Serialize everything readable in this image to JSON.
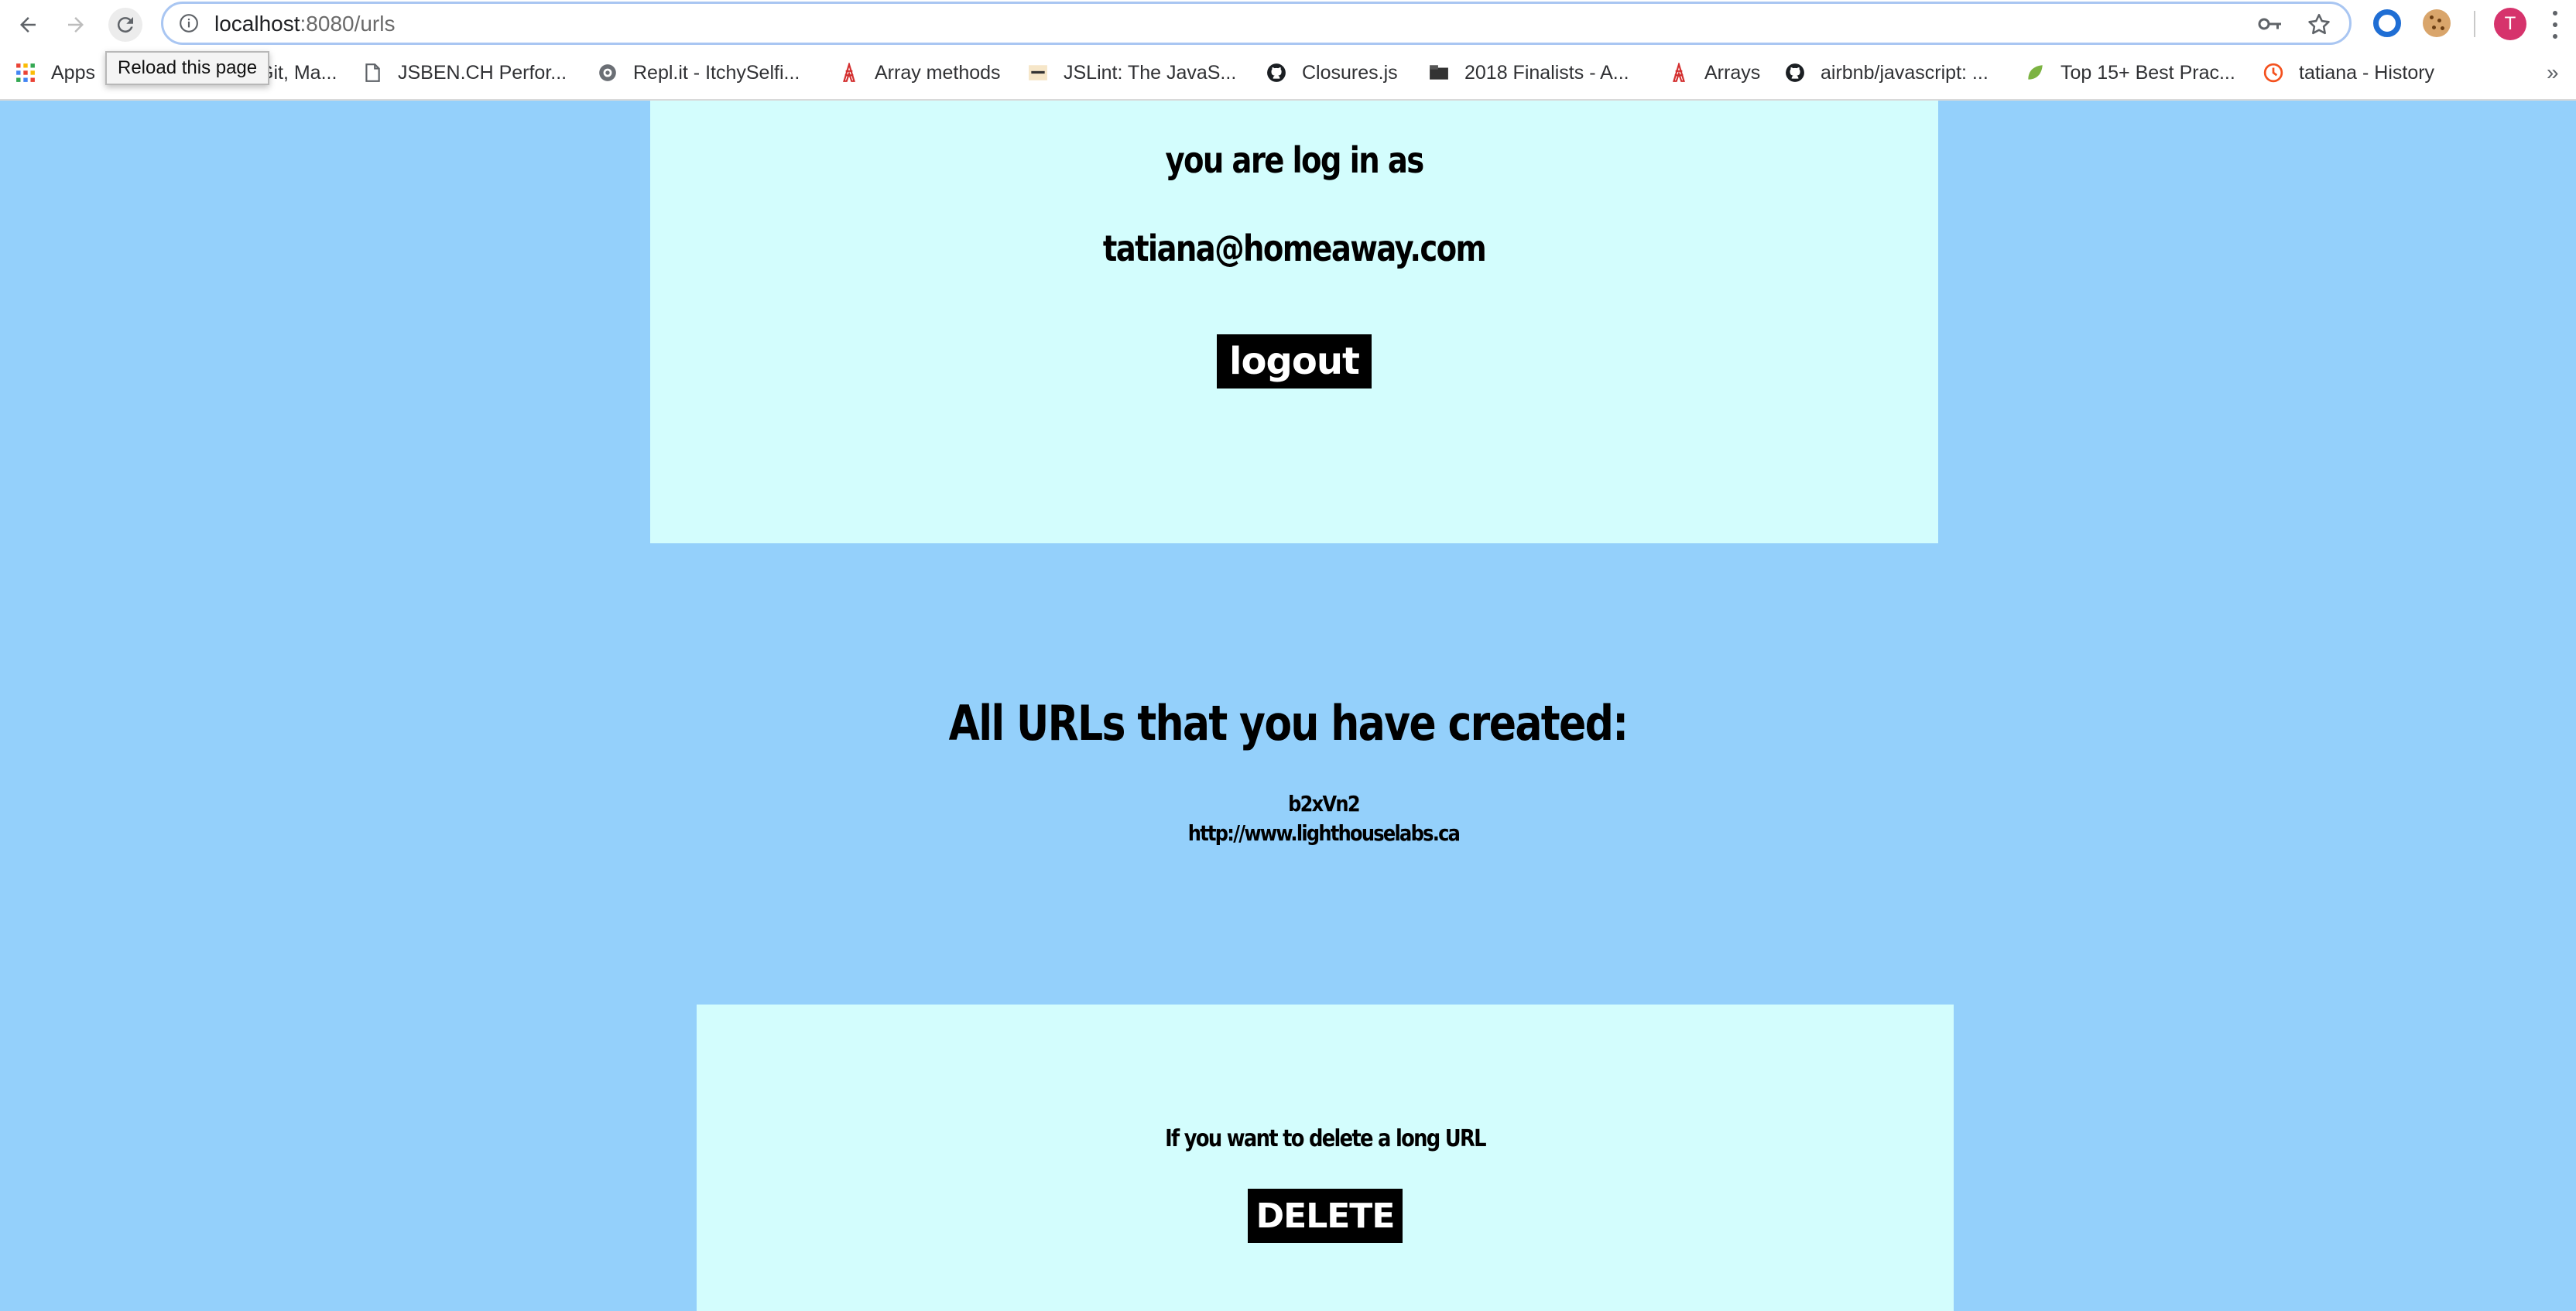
{
  "browser": {
    "url_host": "localhost",
    "url_path": ":8080/urls",
    "reload_tooltip": "Reload this page",
    "avatar_initial": "T",
    "bookmarks": [
      {
        "label": "Apps",
        "icon": "apps-grid-icon"
      },
      {
        "label": "Git, Ma...",
        "icon": "none"
      },
      {
        "label": "JSBEN.CH Perfor...",
        "icon": "page-icon"
      },
      {
        "label": "Repl.it - ItchySelfi...",
        "icon": "replit-icon"
      },
      {
        "label": "Array methods",
        "icon": "tower-icon"
      },
      {
        "label": "JSLint: The JavaS...",
        "icon": "jslint-icon"
      },
      {
        "label": "Closures.js",
        "icon": "github-icon"
      },
      {
        "label": "2018 Finalists - A...",
        "icon": "folder-icon"
      },
      {
        "label": "Arrays",
        "icon": "tower-icon"
      },
      {
        "label": "airbnb/javascript: ...",
        "icon": "github-icon"
      },
      {
        "label": "Top 15+ Best Prac...",
        "icon": "leaf-icon"
      },
      {
        "label": "tatiana - History",
        "icon": "history-icon"
      }
    ],
    "more": "»"
  },
  "login": {
    "status_text": "you are log in as",
    "email": "tatiana@homeaway.com",
    "logout_label": "logout"
  },
  "urls": {
    "heading": "All URLs that you have created:",
    "items": [
      {
        "short": "b2xVn2",
        "long": "http://www.lighthouselabs.ca"
      }
    ]
  },
  "delete": {
    "prompt": "If you want to delete a long URL",
    "button_label": "DELETE"
  },
  "colors": {
    "page_bg": "#94d0fb",
    "panel_bg": "#d3fdfd",
    "button_bg": "#000000"
  }
}
